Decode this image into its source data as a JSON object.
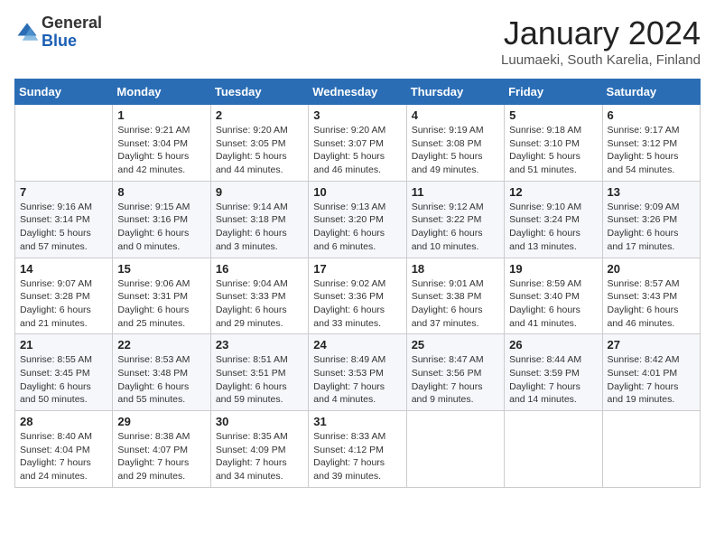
{
  "header": {
    "logo_general": "General",
    "logo_blue": "Blue",
    "title": "January 2024",
    "location": "Luumaeki, South Karelia, Finland"
  },
  "weekdays": [
    "Sunday",
    "Monday",
    "Tuesday",
    "Wednesday",
    "Thursday",
    "Friday",
    "Saturday"
  ],
  "weeks": [
    [
      {
        "day": "",
        "info": ""
      },
      {
        "day": "1",
        "info": "Sunrise: 9:21 AM\nSunset: 3:04 PM\nDaylight: 5 hours\nand 42 minutes."
      },
      {
        "day": "2",
        "info": "Sunrise: 9:20 AM\nSunset: 3:05 PM\nDaylight: 5 hours\nand 44 minutes."
      },
      {
        "day": "3",
        "info": "Sunrise: 9:20 AM\nSunset: 3:07 PM\nDaylight: 5 hours\nand 46 minutes."
      },
      {
        "day": "4",
        "info": "Sunrise: 9:19 AM\nSunset: 3:08 PM\nDaylight: 5 hours\nand 49 minutes."
      },
      {
        "day": "5",
        "info": "Sunrise: 9:18 AM\nSunset: 3:10 PM\nDaylight: 5 hours\nand 51 minutes."
      },
      {
        "day": "6",
        "info": "Sunrise: 9:17 AM\nSunset: 3:12 PM\nDaylight: 5 hours\nand 54 minutes."
      }
    ],
    [
      {
        "day": "7",
        "info": "Sunrise: 9:16 AM\nSunset: 3:14 PM\nDaylight: 5 hours\nand 57 minutes."
      },
      {
        "day": "8",
        "info": "Sunrise: 9:15 AM\nSunset: 3:16 PM\nDaylight: 6 hours\nand 0 minutes."
      },
      {
        "day": "9",
        "info": "Sunrise: 9:14 AM\nSunset: 3:18 PM\nDaylight: 6 hours\nand 3 minutes."
      },
      {
        "day": "10",
        "info": "Sunrise: 9:13 AM\nSunset: 3:20 PM\nDaylight: 6 hours\nand 6 minutes."
      },
      {
        "day": "11",
        "info": "Sunrise: 9:12 AM\nSunset: 3:22 PM\nDaylight: 6 hours\nand 10 minutes."
      },
      {
        "day": "12",
        "info": "Sunrise: 9:10 AM\nSunset: 3:24 PM\nDaylight: 6 hours\nand 13 minutes."
      },
      {
        "day": "13",
        "info": "Sunrise: 9:09 AM\nSunset: 3:26 PM\nDaylight: 6 hours\nand 17 minutes."
      }
    ],
    [
      {
        "day": "14",
        "info": "Sunrise: 9:07 AM\nSunset: 3:28 PM\nDaylight: 6 hours\nand 21 minutes."
      },
      {
        "day": "15",
        "info": "Sunrise: 9:06 AM\nSunset: 3:31 PM\nDaylight: 6 hours\nand 25 minutes."
      },
      {
        "day": "16",
        "info": "Sunrise: 9:04 AM\nSunset: 3:33 PM\nDaylight: 6 hours\nand 29 minutes."
      },
      {
        "day": "17",
        "info": "Sunrise: 9:02 AM\nSunset: 3:36 PM\nDaylight: 6 hours\nand 33 minutes."
      },
      {
        "day": "18",
        "info": "Sunrise: 9:01 AM\nSunset: 3:38 PM\nDaylight: 6 hours\nand 37 minutes."
      },
      {
        "day": "19",
        "info": "Sunrise: 8:59 AM\nSunset: 3:40 PM\nDaylight: 6 hours\nand 41 minutes."
      },
      {
        "day": "20",
        "info": "Sunrise: 8:57 AM\nSunset: 3:43 PM\nDaylight: 6 hours\nand 46 minutes."
      }
    ],
    [
      {
        "day": "21",
        "info": "Sunrise: 8:55 AM\nSunset: 3:45 PM\nDaylight: 6 hours\nand 50 minutes."
      },
      {
        "day": "22",
        "info": "Sunrise: 8:53 AM\nSunset: 3:48 PM\nDaylight: 6 hours\nand 55 minutes."
      },
      {
        "day": "23",
        "info": "Sunrise: 8:51 AM\nSunset: 3:51 PM\nDaylight: 6 hours\nand 59 minutes."
      },
      {
        "day": "24",
        "info": "Sunrise: 8:49 AM\nSunset: 3:53 PM\nDaylight: 7 hours\nand 4 minutes."
      },
      {
        "day": "25",
        "info": "Sunrise: 8:47 AM\nSunset: 3:56 PM\nDaylight: 7 hours\nand 9 minutes."
      },
      {
        "day": "26",
        "info": "Sunrise: 8:44 AM\nSunset: 3:59 PM\nDaylight: 7 hours\nand 14 minutes."
      },
      {
        "day": "27",
        "info": "Sunrise: 8:42 AM\nSunset: 4:01 PM\nDaylight: 7 hours\nand 19 minutes."
      }
    ],
    [
      {
        "day": "28",
        "info": "Sunrise: 8:40 AM\nSunset: 4:04 PM\nDaylight: 7 hours\nand 24 minutes."
      },
      {
        "day": "29",
        "info": "Sunrise: 8:38 AM\nSunset: 4:07 PM\nDaylight: 7 hours\nand 29 minutes."
      },
      {
        "day": "30",
        "info": "Sunrise: 8:35 AM\nSunset: 4:09 PM\nDaylight: 7 hours\nand 34 minutes."
      },
      {
        "day": "31",
        "info": "Sunrise: 8:33 AM\nSunset: 4:12 PM\nDaylight: 7 hours\nand 39 minutes."
      },
      {
        "day": "",
        "info": ""
      },
      {
        "day": "",
        "info": ""
      },
      {
        "day": "",
        "info": ""
      }
    ]
  ]
}
